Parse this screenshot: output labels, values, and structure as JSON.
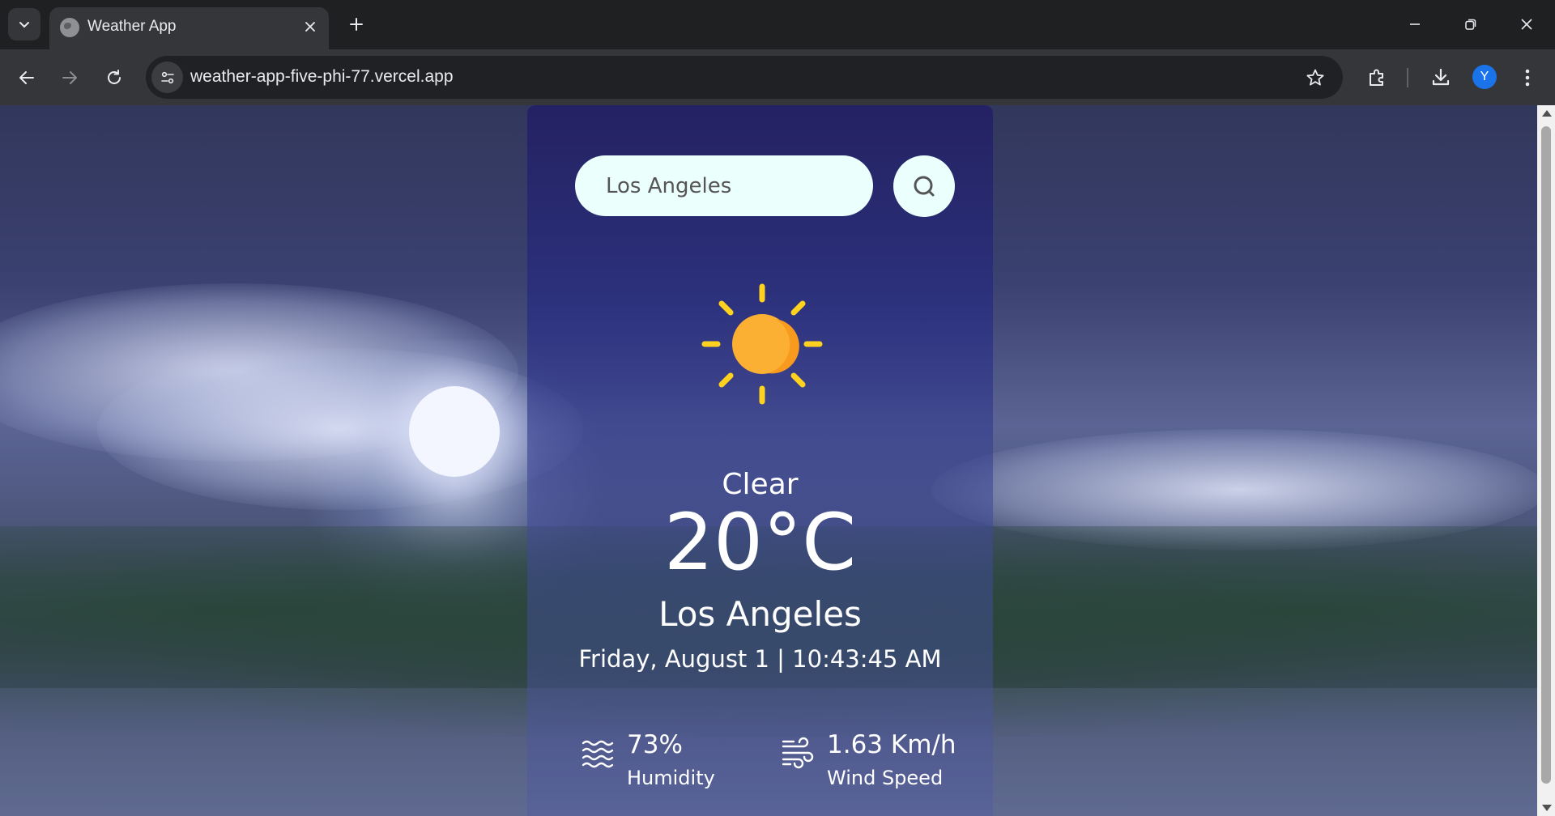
{
  "browser": {
    "tab_title": "Weather App",
    "url": "weather-app-five-phi-77.vercel.app",
    "profile_initial": "Y"
  },
  "weather": {
    "search_value": "Los Angeles",
    "condition": "Clear",
    "temperature": "20°C",
    "city": "Los Angeles",
    "datetime": "Friday, August 1 | 10:43:45 AM",
    "humidity_value": "73%",
    "humidity_label": "Humidity",
    "wind_value": "1.63 Km/h",
    "wind_label": "Wind Speed"
  },
  "colors": {
    "sun": "#fbb034",
    "rays": "#ffd21f",
    "input_bg": "#ebfffc"
  },
  "icons": [
    "tab-search-icon",
    "globe-icon",
    "close-icon",
    "plus-icon",
    "minimize-icon",
    "restore-icon",
    "back-arrow-icon",
    "forward-arrow-icon",
    "reload-icon",
    "site-info-icon",
    "star-icon",
    "extensions-icon",
    "download-icon",
    "more-vert-icon",
    "search-icon",
    "sun-icon",
    "humidity-icon",
    "wind-icon"
  ]
}
